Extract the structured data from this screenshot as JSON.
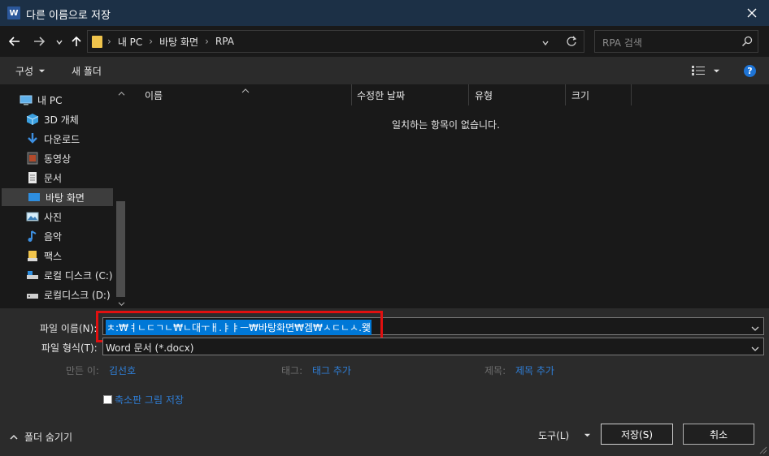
{
  "window": {
    "title": "다른 이름으로 저장",
    "app_badge": "W"
  },
  "nav": {
    "breadcrumb": [
      "내 PC",
      "바탕 화면",
      "RPA"
    ],
    "search_placeholder": "RPA 검색"
  },
  "toolbar": {
    "organize": "구성",
    "new_folder": "새 폴더"
  },
  "sidebar": {
    "items": [
      {
        "label": "내 PC",
        "icon": "pc-icon"
      },
      {
        "label": "3D 개체",
        "icon": "cube-icon"
      },
      {
        "label": "다운로드",
        "icon": "download-icon"
      },
      {
        "label": "동영상",
        "icon": "video-icon"
      },
      {
        "label": "문서",
        "icon": "document-icon"
      },
      {
        "label": "바탕 화면",
        "icon": "desktop-icon"
      },
      {
        "label": "사진",
        "icon": "picture-icon"
      },
      {
        "label": "음악",
        "icon": "music-icon"
      },
      {
        "label": "팩스",
        "icon": "fax-icon"
      },
      {
        "label": "로컬 디스크 (C:)",
        "icon": "drive-icon"
      },
      {
        "label": "로컬디스크 (D:)",
        "icon": "drive-icon"
      }
    ]
  },
  "columns": [
    "이름",
    "수정한 날짜",
    "유형",
    "크기"
  ],
  "empty_message": "일치하는 항목이 없습니다.",
  "form": {
    "filename_label": "파일 이름(N):",
    "filename_value": "ㅊ:₩ㅕㄴㄷㄱㄴ₩ㄴ대ㅜㅐ.ㅑㅑㅡ₩바탕화면₩겜₩ㅅㄷㄴㅅ.왳",
    "filetype_label": "파일 형식(T):",
    "filetype_value": "Word 문서 (*.docx)",
    "author_label": "만든 이:",
    "author_value": "김선호",
    "tags_label": "태그:",
    "tags_value": "태그 추가",
    "title_label": "제목:",
    "title_value": "제목 추가",
    "thumbnail_label": "축소판 그림 저장"
  },
  "footer": {
    "hide_folders": "폴더 숨기기",
    "tools": "도구(L)",
    "save": "저장(S)",
    "cancel": "취소"
  },
  "colors": {
    "highlight_border": "#e01010",
    "selection": "#0078d7",
    "link": "#2f7ed6"
  }
}
